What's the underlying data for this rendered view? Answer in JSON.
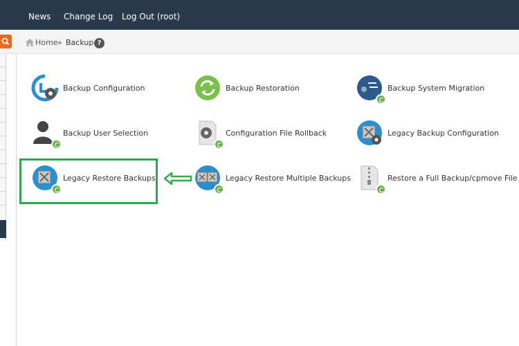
{
  "topnav": {
    "news": "News",
    "change_log": "Change Log",
    "logout": "Log Out (root)"
  },
  "breadcrumb": {
    "home": "Home",
    "separator": "»",
    "current": "Backup",
    "help": "?"
  },
  "tools": [
    {
      "label": "Backup Configuration",
      "icon": "backup-config-icon"
    },
    {
      "label": "Backup Restoration",
      "icon": "backup-restore-icon"
    },
    {
      "label": "Backup System Migration",
      "icon": "migration-icon"
    },
    {
      "label": "Backup User Selection",
      "icon": "user-icon"
    },
    {
      "label": "Configuration File Rollback",
      "icon": "file-rollback-icon"
    },
    {
      "label": "Legacy Backup Configuration",
      "icon": "legacy-config-icon"
    },
    {
      "label": "Legacy Restore Backups",
      "icon": "legacy-restore-icon"
    },
    {
      "label": "Legacy Restore Multiple Backups",
      "icon": "legacy-restore-multiple-icon"
    },
    {
      "label": "Restore a Full Backup/cpmove File",
      "icon": "zip-file-icon"
    }
  ],
  "colors": {
    "topbar": "#293a4a",
    "accent": "#f26522",
    "highlight": "#2eaa4a",
    "icon_blue": "#2a8fcf"
  }
}
